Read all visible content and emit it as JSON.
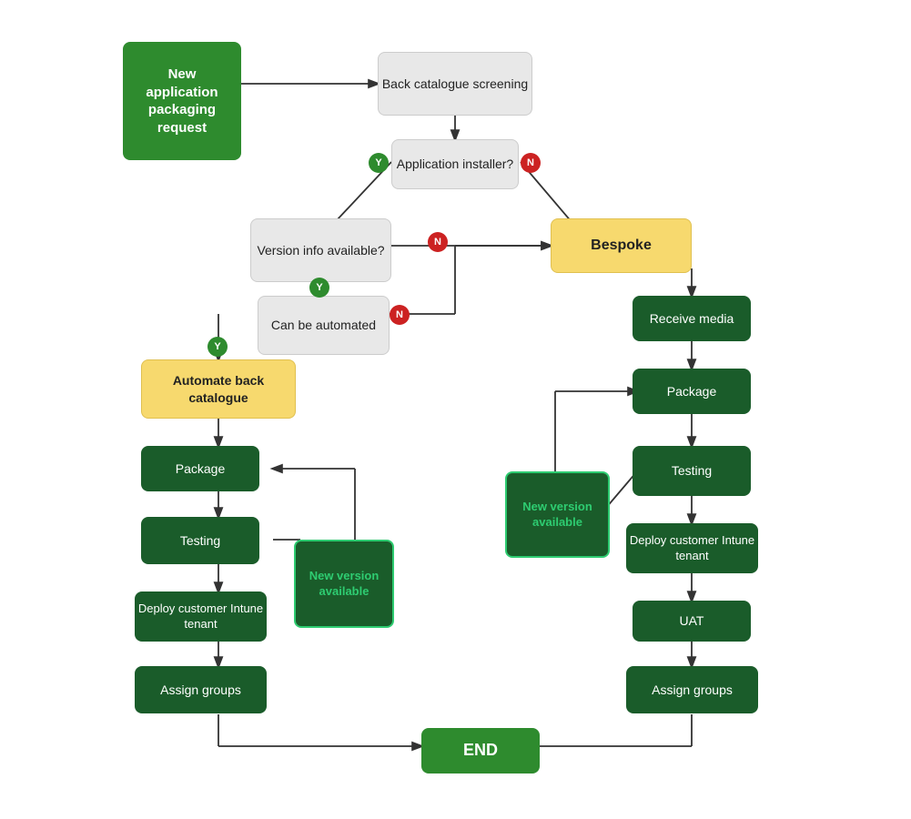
{
  "nodes": {
    "start": {
      "label": "New application packaging request"
    },
    "back_catalogue": {
      "label": "Back catalogue screening"
    },
    "app_installer": {
      "label": "Application installer?"
    },
    "version_info": {
      "label": "Version info available?"
    },
    "can_be_automated": {
      "label": "Can be automated"
    },
    "bespoke": {
      "label": "Bespoke"
    },
    "automate_back": {
      "label": "Automate back catalogue"
    },
    "receive_media": {
      "label": "Receive media"
    },
    "package_left": {
      "label": "Package"
    },
    "package_right": {
      "label": "Package"
    },
    "testing_left": {
      "label": "Testing"
    },
    "testing_right": {
      "label": "Testing"
    },
    "new_version_left": {
      "label": "New version available"
    },
    "new_version_center": {
      "label": "New version available"
    },
    "deploy_left": {
      "label": "Deploy customer Intune tenant"
    },
    "deploy_right": {
      "label": "Deploy customer Intune tenant"
    },
    "assign_left": {
      "label": "Assign groups"
    },
    "uat": {
      "label": "UAT"
    },
    "assign_right": {
      "label": "Assign groups"
    },
    "end": {
      "label": "END"
    }
  },
  "badges": {
    "y1": "Y",
    "n1": "N",
    "y2": "Y",
    "n2": "N",
    "y3": "Y",
    "n3": "N"
  },
  "colors": {
    "green": "#2e8b2e",
    "dark_green": "#1a5c2a",
    "yellow": "#f7d96e",
    "gray": "#e8e8e8",
    "red": "#cc2222",
    "text_green": "#2ecc71"
  }
}
